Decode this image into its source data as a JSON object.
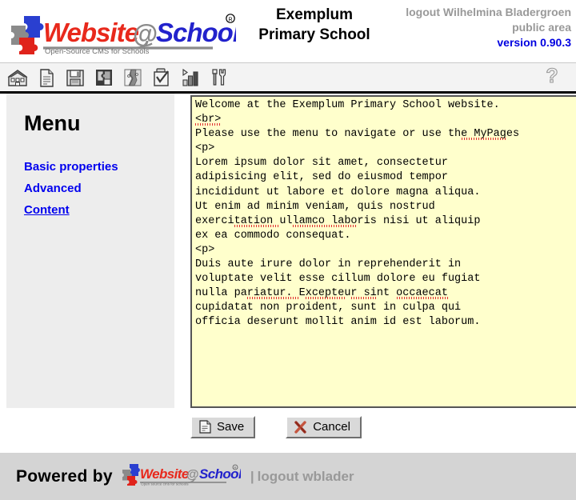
{
  "header": {
    "logo_alt": "Website@School",
    "logo_tagline": "Open-Source CMS for Schools",
    "school_name_line1": "Exemplum",
    "school_name_line2": "Primary School",
    "logout_text": "logout Wilhelmina Bladergroen",
    "area_text": "public area",
    "version_text": "version 0.90.3"
  },
  "toolbar": {
    "items": [
      {
        "name": "home-icon",
        "title": "Home"
      },
      {
        "name": "page-icon",
        "title": "Page"
      },
      {
        "name": "save-icon",
        "title": "Save"
      },
      {
        "name": "modules-icon",
        "title": "Modules"
      },
      {
        "name": "areas-icon",
        "title": "Areas"
      },
      {
        "name": "tasks-icon",
        "title": "Tasks"
      },
      {
        "name": "statistics-icon",
        "title": "Statistics"
      },
      {
        "name": "tools-icon",
        "title": "Tools"
      }
    ],
    "help_title": "Help"
  },
  "menu": {
    "title": "Menu",
    "items": [
      {
        "label": "Basic properties",
        "active": false
      },
      {
        "label": "Advanced",
        "active": false
      },
      {
        "label": "Content",
        "active": true
      }
    ]
  },
  "editor": {
    "value": "Welcome at the Exemplum Primary School website.\n<br>\nPlease use the menu to navigate or use the MyPages\n<p>\nLorem ipsum dolor sit amet, consectetur\nadipisicing elit, sed do eiusmod tempor\nincididunt ut labore et dolore magna aliqua.\nUt enim ad minim veniam, quis nostrud\nexercitation ullamco laboris nisi ut aliquip\nex ea commodo consequat.\n<p>\nDuis aute irure dolor in reprehenderit in\nvoluptate velit esse cillum dolore eu fugiat\nnulla pariatur. Excepteur sint occaecat\ncupidatat non proident, sunt in culpa qui\nofficia deserunt mollit anim id est laborum."
  },
  "buttons": {
    "save_label": "Save",
    "cancel_label": "Cancel"
  },
  "footer": {
    "powered_by": "Powered by",
    "logo_alt": "Website@School",
    "logo_tagline": "Open source cms for schools",
    "separator": "|",
    "logout_label": "logout wblader"
  },
  "colors": {
    "link": "#0000ee",
    "version": "#0000e0",
    "editor_bg": "#ffffcc",
    "menu_bg": "#ededed",
    "footer_bg": "#d4d4d4",
    "logo_red": "#e8291c",
    "logo_blue": "#2222cc",
    "muted_text": "#999999"
  }
}
